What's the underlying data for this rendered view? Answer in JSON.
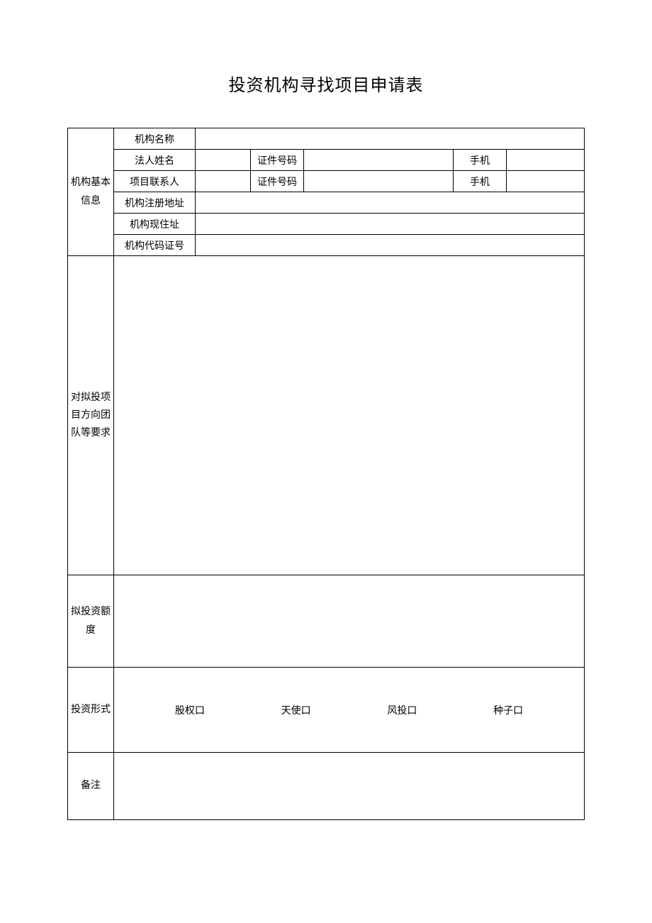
{
  "title": "投资机构寻找项目申请表",
  "sections": {
    "basic_info": {
      "label": "机构基本信息",
      "rows": {
        "org_name": {
          "label": "机构名称",
          "value": ""
        },
        "legal_person": {
          "label": "法人姓名",
          "value": "",
          "id_label": "证件号码",
          "id_value": "",
          "phone_label": "手机",
          "phone_value": ""
        },
        "contact_person": {
          "label": "项目联系人",
          "value": "",
          "id_label": "证件号码",
          "id_value": "",
          "phone_label": "手机",
          "phone_value": ""
        },
        "reg_address": {
          "label": "机构注册地址",
          "value": ""
        },
        "current_address": {
          "label": "机构现住址",
          "value": ""
        },
        "org_code": {
          "label": "机构代码证号",
          "value": ""
        }
      }
    },
    "requirements": {
      "label": "对拟投项目方向团队等要求",
      "value": ""
    },
    "invest_amount": {
      "label": "拟投资额度",
      "value": ""
    },
    "invest_form": {
      "label": "投资形式",
      "options": [
        {
          "label": "股权",
          "checked": false
        },
        {
          "label": "天使",
          "checked": false
        },
        {
          "label": "风投",
          "checked": false
        },
        {
          "label": "种子",
          "checked": false
        }
      ],
      "checkbox_glyph": "口"
    },
    "remark": {
      "label": "备注",
      "value": ""
    }
  }
}
